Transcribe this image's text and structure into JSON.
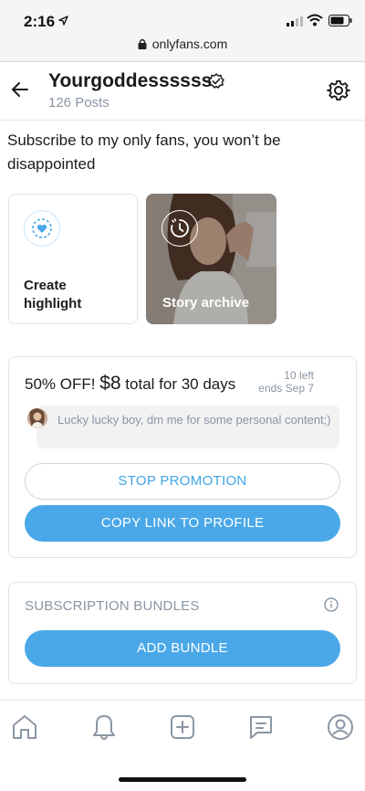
{
  "status_bar": {
    "time": "2:16",
    "url": "onlyfans.com"
  },
  "header": {
    "name": "Yourgoddessssss",
    "posts": "126 Posts"
  },
  "bio": "Subscribe to my only fans, you won’t be disappointed",
  "highlights": {
    "create_label": "Create\nhighlight",
    "story_archive_label": "Story archive"
  },
  "promotion": {
    "discount": "50% OFF!",
    "price": "$8",
    "period": "total for 30 days",
    "left": "10 left",
    "ends": "ends Sep 7",
    "message": "Lucky lucky boy, dm me for some personal content;)",
    "stop_button": "STOP PROMOTION",
    "copy_button": "COPY LINK TO PROFILE"
  },
  "bundles": {
    "title": "SUBSCRIPTION BUNDLES",
    "add_button": "ADD BUNDLE"
  },
  "nav": [
    "home-icon",
    "bell-icon",
    "add-post-icon",
    "messages-icon",
    "profile-icon"
  ],
  "colors": {
    "accent": "#4aa8e8",
    "muted": "#8a96a3"
  }
}
